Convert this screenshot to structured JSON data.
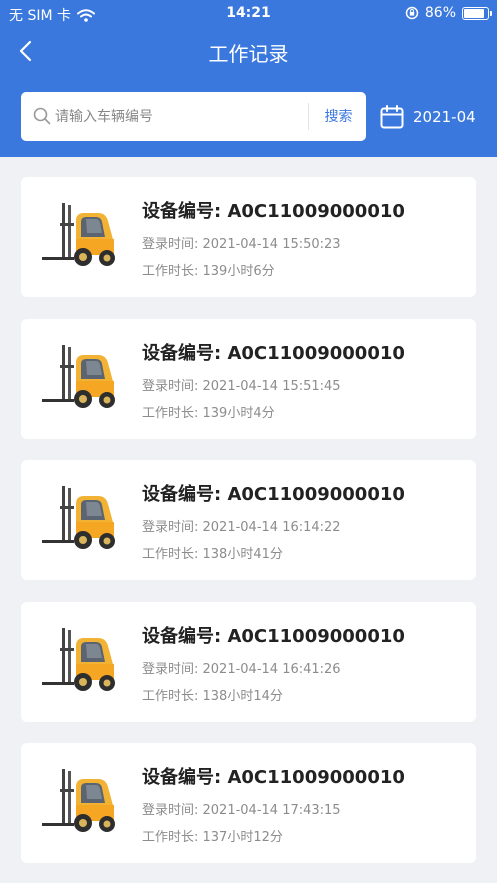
{
  "status_bar": {
    "carrier": "无 SIM 卡",
    "time": "14:21",
    "battery": "86%",
    "battery_level": 0.86
  },
  "nav": {
    "title": "工作记录"
  },
  "search": {
    "placeholder": "请输入车辆编号",
    "value": "",
    "button_label": "搜索"
  },
  "date_filter": {
    "value": "2021-04"
  },
  "records": [
    {
      "device_label": "设备编号: A0C11009000010",
      "login_time": "登录时间: 2021-04-14 15:50:23",
      "duration": "工作时长: 139小时6分"
    },
    {
      "device_label": "设备编号: A0C11009000010",
      "login_time": "登录时间: 2021-04-14 15:51:45",
      "duration": "工作时长: 139小时4分"
    },
    {
      "device_label": "设备编号: A0C11009000010",
      "login_time": "登录时间: 2021-04-14 16:14:22",
      "duration": "工作时长: 138小时41分"
    },
    {
      "device_label": "设备编号: A0C11009000010",
      "login_time": "登录时间: 2021-04-14 16:41:26",
      "duration": "工作时长: 138小时14分"
    },
    {
      "device_label": "设备编号: A0C11009000010",
      "login_time": "登录时间: 2021-04-14 17:43:15",
      "duration": "工作时长: 137小时12分"
    }
  ],
  "icons": {
    "back": "chevron-left-icon",
    "search": "search-icon",
    "calendar": "calendar-icon",
    "record": "forklift-icon",
    "wifi": "wifi-icon",
    "orientation_lock": "orientation-lock-icon",
    "battery": "battery-icon"
  },
  "colors": {
    "primary": "#3a78de",
    "background": "#f0f1f5",
    "forklift_body": "#f2b233"
  }
}
